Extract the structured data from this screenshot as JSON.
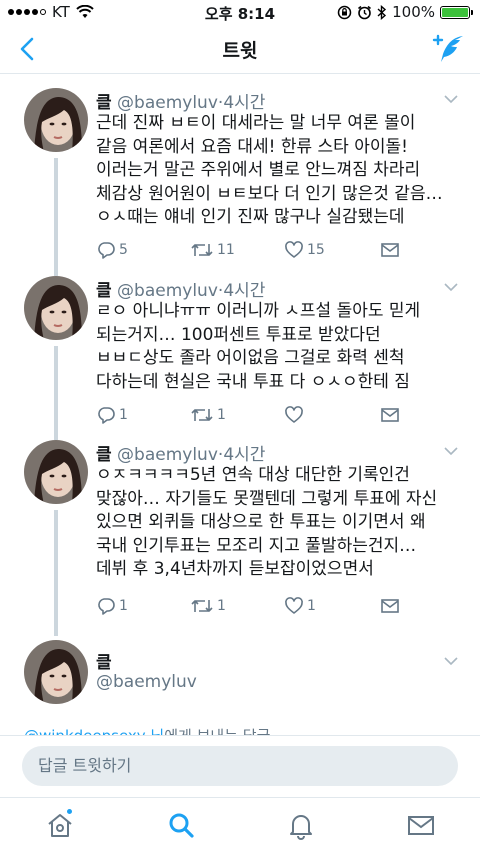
{
  "status_bar": {
    "carrier": "KT",
    "time": "오후 8:14",
    "battery": "100%",
    "battery_level": 1.0
  },
  "nav": {
    "title": "트윗",
    "back_icon": "chevron-left-icon",
    "compose_icon": "compose-tweet-icon"
  },
  "tweets": [
    {
      "name": "클",
      "handle": "@baemyluv",
      "dot": "·",
      "time": "4시간",
      "text": "근데 진짜 ㅂㅌ이 대세라는 말 너무 여론 몰이\n같음 여론에서 요즘 대세! 한류 스타 아이돌!\n이러는거 말곤 주위에서 별로 안느껴짐 차라리\n체감상 원어원이 ㅂㅌ보다 더 인기 많은것 같음…\nㅇㅅ때는 얘네 인기 진짜 많구나 실감됐는데",
      "replies": "5",
      "retweets": "11",
      "likes": "15"
    },
    {
      "name": "클",
      "handle": "@baemyluv",
      "dot": "·",
      "time": "4시간",
      "text": "ㄹㅇ 아니냐ㅠㅠ 이러니까 ㅅ프설 돌아도 믿게\n되는거지… 100퍼센트 투표로 받았다던\nㅂㅂㄷ상도 졸라 어이없음 그걸로 화력 센척\n다하는데 현실은 국내 투표 다 ㅇㅅㅇ한테 짐",
      "replies": "1",
      "retweets": "1",
      "likes": ""
    },
    {
      "name": "클",
      "handle": "@baemyluv",
      "dot": "·",
      "time": "4시간",
      "text": "ㅇㅈㅋㅋㅋㅋ5년 연속 대상 대단한 기록인건\n맞잖아… 자기들도 못깰텐데 그렇게 투표에 자신\n있으면 외퀴들 대상으로 한 투표는 이기면서 왜\n국내 인기투표는 모조리 지고 풀발하는건지…\n데뷔 후 3,4년차까지 듣보잡이었으면서",
      "replies": "1",
      "retweets": "1",
      "likes": "1"
    }
  ],
  "focused_tweet": {
    "name": "클",
    "handle": "@baemyluv"
  },
  "replying_to": {
    "user": "@winkdeepsexy 님",
    "suffix": "에게 보내는 답글"
  },
  "composer": {
    "placeholder": "답글 트윗하기"
  },
  "tab_bar": {
    "items": [
      "home-icon",
      "search-icon",
      "notifications-icon",
      "messages-icon"
    ],
    "accent": "#1da1f2"
  },
  "colors": {
    "accent": "#1da1f2",
    "secondary_text": "#657786",
    "battery": "#3cc13b"
  }
}
